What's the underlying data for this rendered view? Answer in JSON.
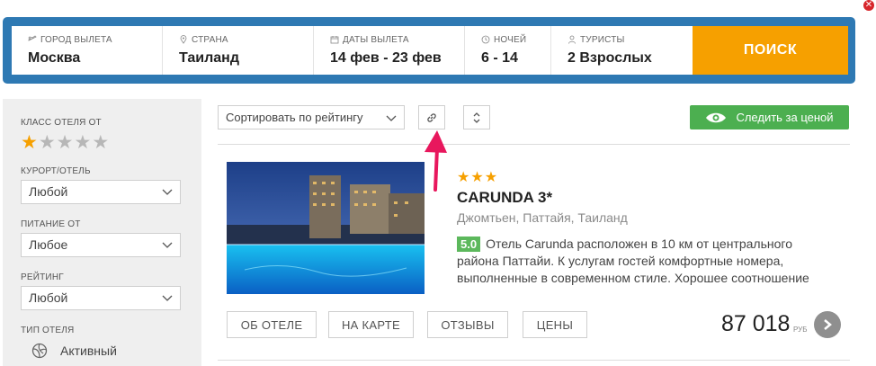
{
  "search": {
    "departure": {
      "label": "ГОРОД ВЫЛЕТА",
      "value": "Москва",
      "icon": "plane-icon"
    },
    "country": {
      "label": "СТРАНА",
      "value": "Таиланд",
      "icon": "location-pin-icon"
    },
    "dates": {
      "label": "ДАТЫ ВЫЛЕТА",
      "value": "14 фев - 23 фев",
      "icon": "calendar-icon"
    },
    "nights": {
      "label": "НОЧЕЙ",
      "value": "6 - 14",
      "icon": "clock-icon"
    },
    "tourists": {
      "label": "ТУРИСТЫ",
      "value": "2 Взрослых",
      "icon": "person-icon"
    },
    "button": "ПОИСК",
    "colors": {
      "bar": "#2e79b3",
      "button": "#f6a000"
    }
  },
  "filters": {
    "hotel_class": {
      "label": "КЛАСС ОТЕЛЯ ОТ",
      "stars_selected": 1,
      "stars_total": 5
    },
    "resort": {
      "label": "КУРОРТ/ОТЕЛЬ",
      "value": "Любой"
    },
    "meal": {
      "label": "ПИТАНИЕ ОТ",
      "value": "Любое"
    },
    "rating": {
      "label": "РЕЙТИНГ",
      "value": "Любой"
    },
    "hotel_type": {
      "label": "ТИП ОТЕЛЯ",
      "option": "Активный"
    }
  },
  "toolbar": {
    "sort": "Сортировать по рейтингу",
    "watch_price": "Следить за ценой",
    "watch_color": "#4caf50"
  },
  "hotel": {
    "stars": 3,
    "name": "CARUNDA 3*",
    "location": "Джомтьен, Паттайя, Таиланд",
    "score": "5.0",
    "description": "Отель Carunda расположен в 10 км от центрального района Паттайи. К услугам гостей комфортные номера, выполненные в современном стиле. Хорошее соотношение",
    "tabs": [
      "ОБ ОТЕЛЕ",
      "НА КАРТЕ",
      "ОТЗЫВЫ",
      "ЦЕНЫ"
    ],
    "price": "87 018",
    "currency": "РУБ"
  }
}
